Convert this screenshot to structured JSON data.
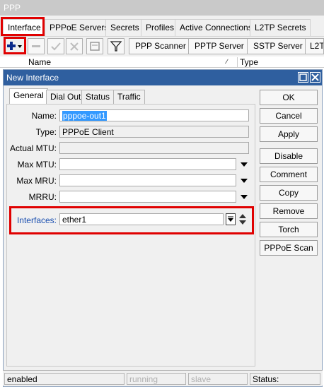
{
  "window": {
    "title": "PPP"
  },
  "tabs": [
    {
      "label": "Interface"
    },
    {
      "label": "PPPoE Servers"
    },
    {
      "label": "Secrets"
    },
    {
      "label": "Profiles"
    },
    {
      "label": "Active Connections"
    },
    {
      "label": "L2TP Secrets"
    }
  ],
  "toolbar": {
    "buttons": [
      {
        "label": "PPP Scanner"
      },
      {
        "label": "PPTP Server"
      },
      {
        "label": "SSTP Server"
      },
      {
        "label": "L2T"
      }
    ]
  },
  "list": {
    "columns": [
      {
        "label": "Name"
      },
      {
        "label": "Type"
      }
    ]
  },
  "dialog": {
    "title": "New Interface",
    "tabs": [
      {
        "label": "General"
      },
      {
        "label": "Dial Out"
      },
      {
        "label": "Status"
      },
      {
        "label": "Traffic"
      }
    ],
    "fields": {
      "name": {
        "label": "Name:",
        "value": "pppoe-out1"
      },
      "type": {
        "label": "Type:",
        "value": "PPPoE Client"
      },
      "actual_mtu": {
        "label": "Actual MTU:",
        "value": ""
      },
      "max_mtu": {
        "label": "Max MTU:",
        "value": ""
      },
      "max_mru": {
        "label": "Max MRU:",
        "value": ""
      },
      "mrru": {
        "label": "MRRU:",
        "value": ""
      },
      "interfaces": {
        "label": "Interfaces:",
        "value": "ether1"
      }
    },
    "buttons": [
      {
        "label": "OK"
      },
      {
        "label": "Cancel"
      },
      {
        "label": "Apply"
      },
      {
        "label": "Disable"
      },
      {
        "label": "Comment"
      },
      {
        "label": "Copy"
      },
      {
        "label": "Remove"
      },
      {
        "label": "Torch"
      },
      {
        "label": "PPPoE Scan"
      }
    ],
    "status": {
      "state": "enabled",
      "running": "running",
      "slave": "slave",
      "status_label": "Status:"
    }
  },
  "colors": {
    "dialog_title": "#2f5f9f",
    "highlight": "#e00000",
    "interfaces_label": "#1a4fb0",
    "add_icon": "#0a2a8a"
  }
}
